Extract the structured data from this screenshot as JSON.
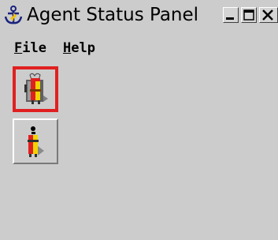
{
  "window": {
    "title": "Agent Status Panel",
    "app_icon": "anchor-icon",
    "controls": {
      "minimize_icon": "minimize-icon",
      "maximize_icon": "maximize-icon",
      "close_icon": "close-icon"
    }
  },
  "menubar": {
    "file": {
      "mnemonic": "F",
      "rest": "ile"
    },
    "help": {
      "mnemonic": "H",
      "rest": "elp"
    }
  },
  "agents": [
    {
      "icon": "agent-gift-icon",
      "selected": true
    },
    {
      "icon": "agent-figure-icon",
      "selected": false
    }
  ],
  "colors": {
    "window_bg": "#cccccc",
    "selection_border": "#e02020"
  }
}
